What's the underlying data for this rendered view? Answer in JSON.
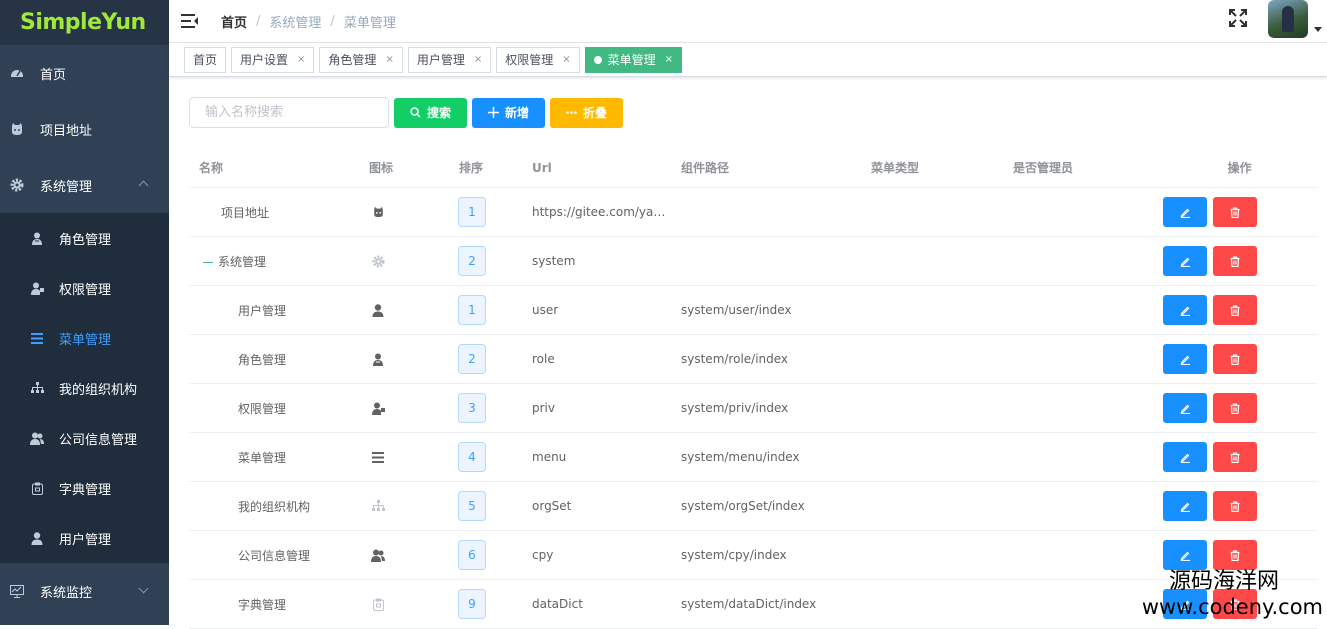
{
  "app": {
    "logo": "SimpleYun"
  },
  "sidebar": {
    "items": [
      {
        "label": "首页",
        "icon": "dashboard-icon"
      },
      {
        "label": "项目地址",
        "icon": "github-icon"
      },
      {
        "label": "系统管理",
        "icon": "gear-icon",
        "expanded": true,
        "children": [
          {
            "label": "角色管理",
            "icon": "role-icon"
          },
          {
            "label": "权限管理",
            "icon": "permission-icon"
          },
          {
            "label": "菜单管理",
            "icon": "menu-list-icon",
            "active": true
          },
          {
            "label": "我的组织机构",
            "icon": "org-tree-icon"
          },
          {
            "label": "公司信息管理",
            "icon": "company-icon"
          },
          {
            "label": "字典管理",
            "icon": "dict-icon"
          },
          {
            "label": "用户管理",
            "icon": "user-icon"
          }
        ]
      },
      {
        "label": "系统监控",
        "icon": "monitor-icon"
      }
    ]
  },
  "navbar": {
    "breadcrumb": [
      "首页",
      "系统管理",
      "菜单管理"
    ],
    "separator": "/"
  },
  "tags": [
    {
      "label": "首页",
      "closable": false
    },
    {
      "label": "用户设置",
      "closable": true
    },
    {
      "label": "角色管理",
      "closable": true
    },
    {
      "label": "用户管理",
      "closable": true
    },
    {
      "label": "权限管理",
      "closable": true
    },
    {
      "label": "菜单管理",
      "closable": true,
      "active": true
    }
  ],
  "tag_close": "×",
  "toolbar": {
    "search_placeholder": "输入名称搜索",
    "search_label": "搜索",
    "add_label": "新增",
    "fold_label": "折叠"
  },
  "table": {
    "headers": [
      "名称",
      "图标",
      "排序",
      "Url",
      "组件路径",
      "菜单类型",
      "是否管理员",
      "操作"
    ],
    "rows": [
      {
        "name": "项目地址",
        "icon": "github-icon",
        "sort": "1",
        "url": "https://gitee.com/yan...",
        "path": "",
        "level": 0
      },
      {
        "name": "系统管理",
        "icon": "gear-icon",
        "sort": "2",
        "url": "system",
        "path": "",
        "level": 0,
        "expanded": true
      },
      {
        "name": "用户管理",
        "icon": "user-icon",
        "sort": "1",
        "url": "user",
        "path": "system/user/index",
        "level": 1
      },
      {
        "name": "角色管理",
        "icon": "role-icon",
        "sort": "2",
        "url": "role",
        "path": "system/role/index",
        "level": 1
      },
      {
        "name": "权限管理",
        "icon": "permission-icon",
        "sort": "3",
        "url": "priv",
        "path": "system/priv/index",
        "level": 1
      },
      {
        "name": "菜单管理",
        "icon": "menu-list-icon",
        "sort": "4",
        "url": "menu",
        "path": "system/menu/index",
        "level": 1
      },
      {
        "name": "我的组织机构",
        "icon": "org-tree-icon",
        "sort": "5",
        "url": "orgSet",
        "path": "system/orgSet/index",
        "level": 1
      },
      {
        "name": "公司信息管理",
        "icon": "company-icon",
        "sort": "6",
        "url": "cpy",
        "path": "system/cpy/index",
        "level": 1
      },
      {
        "name": "字典管理",
        "icon": "dict-icon",
        "sort": "9",
        "url": "dataDict",
        "path": "system/dataDict/index",
        "level": 1
      }
    ]
  },
  "watermark": {
    "line1": "源码海洋网",
    "line2": "www.codeny.com"
  },
  "colors": {
    "sidebar_bg": "#304156",
    "submenu_bg": "#1f2d3d",
    "active": "#409eff",
    "tag_active": "#42b983",
    "btn_search": "#13ce66",
    "btn_add": "#1890ff",
    "btn_fold": "#ffba00",
    "btn_delete": "#ff4949"
  }
}
